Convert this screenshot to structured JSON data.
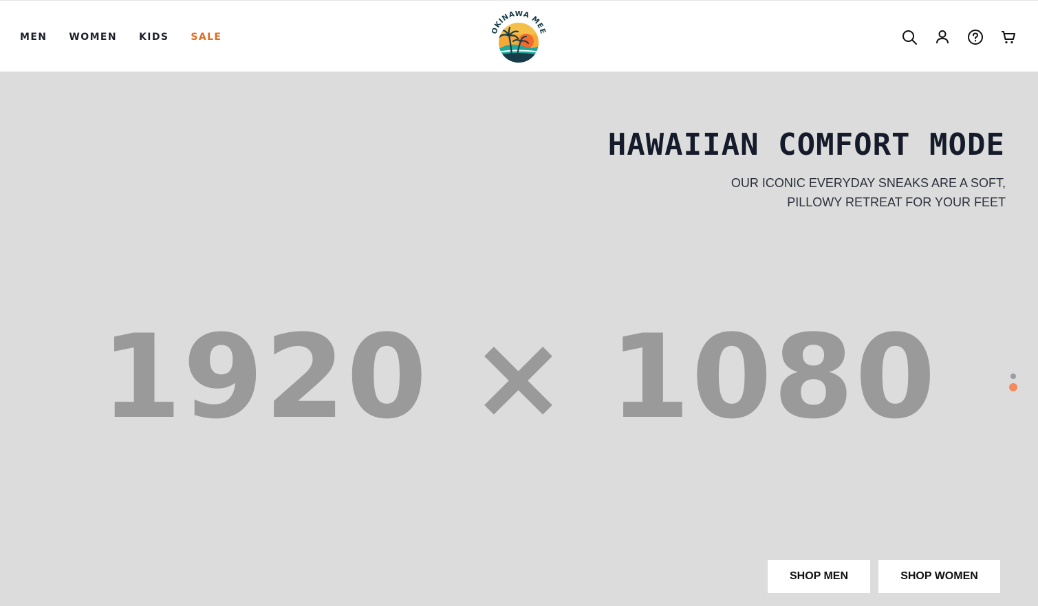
{
  "nav": {
    "items": [
      {
        "label": "MEN"
      },
      {
        "label": "WOMEN"
      },
      {
        "label": "KIDS"
      },
      {
        "label": "SALE"
      }
    ],
    "sale_color": "#e26a1d"
  },
  "logo": {
    "brand_text": "OKINAWA MEE",
    "colors": {
      "sun": "#f7a935",
      "sea": "#23a99b",
      "dark": "#163c4a"
    }
  },
  "header_icons": [
    "search-icon",
    "user-icon",
    "help-icon",
    "cart-icon"
  ],
  "hero": {
    "title": "HAWAIIAN COMFORT MODE",
    "subtitle": "OUR ICONIC EVERYDAY SNEAKS ARE A SOFT, PILLOWY RETREAT FOR YOUR FEET",
    "placeholder": "1920 × 1080",
    "background": "#dcdcdc",
    "slides_total": 2,
    "active_slide": 2,
    "buttons": {
      "shop_men": "SHOP MEN",
      "shop_women": "SHOP WOMEN"
    }
  }
}
